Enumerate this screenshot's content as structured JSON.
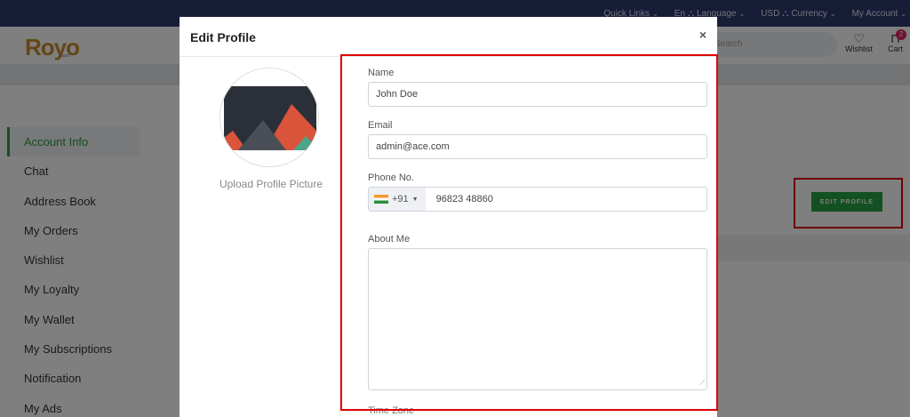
{
  "topnav": {
    "quick_links": "Quick Links",
    "lang_code": "En",
    "language": "Language",
    "currency_code": "USD",
    "currency": "Currency",
    "account": "My Account"
  },
  "header": {
    "logo_main": "Royo",
    "logo_sub": "apps",
    "search_placeholder": "Search",
    "wishlist": "Wishlist",
    "cart": "Cart",
    "cart_count": "2"
  },
  "sidebar": {
    "items": [
      {
        "label": "Account Info",
        "active": true
      },
      {
        "label": "Chat"
      },
      {
        "label": "Address Book"
      },
      {
        "label": "My Orders"
      },
      {
        "label": "Wishlist"
      },
      {
        "label": "My Loyalty"
      },
      {
        "label": "My Wallet"
      },
      {
        "label": "My Subscriptions"
      },
      {
        "label": "Notification"
      },
      {
        "label": "My Ads"
      }
    ]
  },
  "page": {
    "edit_profile_button": "EDIT PROFILE"
  },
  "modal": {
    "title": "Edit Profile",
    "close": "×",
    "upload_label": "Upload Profile Picture",
    "fields": {
      "name_label": "Name",
      "name_value": "John Doe",
      "email_label": "Email",
      "email_value": "admin@ace.com",
      "phone_label": "Phone No.",
      "country_code": "+91",
      "phone_value": "96823 48860",
      "about_label": "About Me",
      "about_value": "",
      "timezone_label": "Time Zone"
    }
  },
  "colors": {
    "topbar": "#2f3b6e",
    "accent_green": "#27a244",
    "highlight_red": "#e00000"
  }
}
